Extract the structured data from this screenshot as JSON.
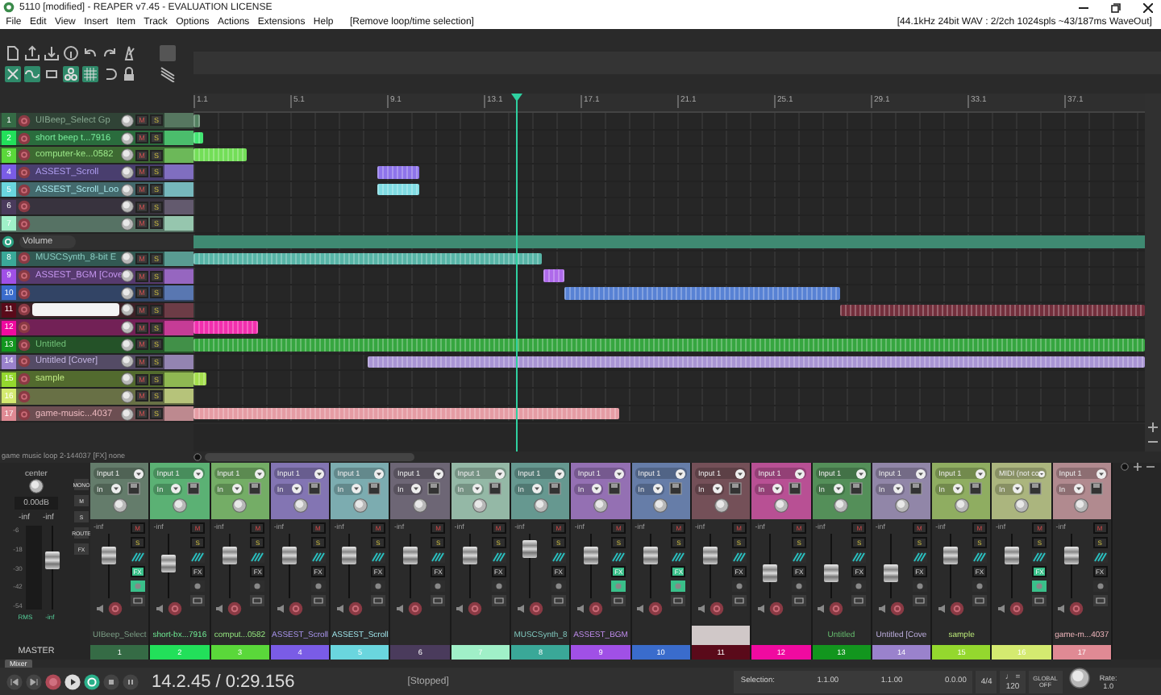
{
  "window": {
    "title": "5110 [modified] - REAPER v7.45 - EVALUATION LICENSE"
  },
  "menu": [
    "File",
    "Edit",
    "View",
    "Insert",
    "Item",
    "Track",
    "Options",
    "Actions",
    "Extensions",
    "Help"
  ],
  "menu_hint": "[Remove loop/time selection]",
  "audio_status": "[44.1kHz 24bit WAV : 2/2ch 1024spls ~43/187ms WaveOut]",
  "toolbar": [
    {
      "on": false
    },
    {
      "on": false
    },
    {
      "on": false
    },
    {
      "on": false
    },
    {
      "on": false
    },
    {
      "on": false
    },
    {
      "on": false
    },
    {
      "on": true
    },
    {
      "on": true
    },
    {
      "on": false
    },
    {
      "on": true
    },
    {
      "on": true
    },
    {
      "on": false
    },
    {
      "on": false
    }
  ],
  "ruler": [
    "1.1",
    "5.1",
    "9.1",
    "13.1",
    "17.1",
    "21.1",
    "25.1",
    "29.1",
    "33.1",
    "37.1"
  ],
  "tracks": [
    {
      "kind": "track",
      "number": "1",
      "name": "UIBeep_Select Gp",
      "color": "#356b45",
      "selected": false,
      "buttons": [
        "M",
        "S"
      ]
    },
    {
      "kind": "track",
      "number": "2",
      "name": "short beep t...7916",
      "color": "#22e05a",
      "selected": false,
      "buttons": [
        "M",
        "S"
      ]
    },
    {
      "kind": "track",
      "number": "3",
      "name": "computer-ke...0582",
      "color": "#5ad83a",
      "selected": false,
      "buttons": [
        "M",
        "S"
      ]
    },
    {
      "kind": "track",
      "number": "4",
      "name": "ASSEST_Scroll",
      "color": "#7a5ce6",
      "selected": false,
      "buttons": [
        "M",
        "S"
      ]
    },
    {
      "kind": "track",
      "number": "5",
      "name": "ASSEST_Scroll_Loo",
      "color": "#6ad6de",
      "selected": false,
      "buttons": [
        "M",
        "S"
      ]
    },
    {
      "kind": "track",
      "number": "6",
      "color": "#4a3b5c",
      "selected": false,
      "buttons": [
        "M",
        "S"
      ]
    },
    {
      "kind": "track",
      "number": "7",
      "color": "#a0f0c8",
      "selected": false,
      "buttons": [
        "M",
        "S"
      ]
    },
    {
      "kind": "envelope",
      "name": "Volume"
    },
    {
      "kind": "track",
      "number": "8",
      "name": "MUSCSynth_8-bit E",
      "color": "#3aa898",
      "selected": false,
      "buttons": [
        "M",
        "S"
      ]
    },
    {
      "kind": "track",
      "number": "9",
      "name": "ASSEST_BGM [Cove",
      "color": "#a050e6",
      "selected": false,
      "buttons": [
        "M",
        "S"
      ]
    },
    {
      "kind": "track",
      "number": "10",
      "color": "#3a6ccc",
      "selected": false,
      "buttons": [
        "M",
        "S"
      ]
    },
    {
      "kind": "track",
      "number": "11",
      "color": "#5a0a1a",
      "selected": true,
      "buttons": [
        "M",
        "S"
      ]
    },
    {
      "kind": "track",
      "number": "12",
      "color": "#f00aa0",
      "selected": false,
      "buttons": [
        "M",
        "S"
      ]
    },
    {
      "kind": "track",
      "number": "13",
      "name": "Untitled",
      "color": "#12961e",
      "selected": false,
      "buttons": [
        "M",
        "S"
      ]
    },
    {
      "kind": "track",
      "number": "14",
      "name": "Untitled [Cover]",
      "color": "#9a82cc",
      "selected": false,
      "buttons": [
        "M",
        "S"
      ]
    },
    {
      "kind": "track",
      "number": "15",
      "name": "sample",
      "color": "#94d82e",
      "selected": false,
      "buttons": [
        "M",
        "S"
      ]
    },
    {
      "kind": "track",
      "number": "16",
      "color": "#d4ea70",
      "selected": false,
      "buttons": [
        "M",
        "S"
      ]
    },
    {
      "kind": "track",
      "number": "17",
      "name": "game-music...4037",
      "color": "#e08a94",
      "selected": false,
      "buttons": [
        "M",
        "S"
      ]
    }
  ],
  "status_line": "game music loop 2-144037 [FX] none",
  "master": {
    "pan_label": "center",
    "volume": "0.00dB",
    "peaks": [
      "-inf",
      "-inf"
    ],
    "meter_ticks": [
      "-6",
      "-18",
      "-30",
      "-42",
      "-54"
    ],
    "rms": "RMS",
    "rms_value": "-inf",
    "label": "MASTER",
    "level": 0.6,
    "side_buttons": [
      "MONO",
      "M",
      "S",
      "ROUTE",
      "FX"
    ]
  },
  "mixer": [
    {
      "number": "1",
      "name": "UIBeep_Select",
      "input": "Input 1",
      "monitor": "In",
      "peak": "-inf",
      "level": 0.72,
      "fx_active": true,
      "selected": false,
      "color": "#356b45",
      "buttons": [
        "M",
        "S",
        "FX"
      ]
    },
    {
      "number": "2",
      "name": "short-bx...7916",
      "input": "Input 1",
      "monitor": "In",
      "peak": "-inf",
      "level": 0.55,
      "fx_active": false,
      "selected": false,
      "color": "#22e05a",
      "buttons": [
        "M",
        "S",
        "FX"
      ]
    },
    {
      "number": "3",
      "name": "comput...0582",
      "input": "Input 1",
      "monitor": "In",
      "peak": "-inf",
      "level": 0.72,
      "fx_active": false,
      "selected": false,
      "color": "#5ad83a",
      "buttons": [
        "M",
        "S",
        "FX"
      ]
    },
    {
      "number": "4",
      "name": "ASSEST_Scroll",
      "input": "Input 1",
      "monitor": "In",
      "peak": "-inf",
      "level": 0.72,
      "fx_active": false,
      "selected": false,
      "color": "#7a5ce6",
      "buttons": [
        "M",
        "S",
        "FX"
      ]
    },
    {
      "number": "5",
      "name": "ASSEST_Scroll",
      "input": "Input 1",
      "monitor": "In",
      "peak": "-inf",
      "level": 0.72,
      "fx_active": false,
      "selected": false,
      "color": "#6ad6de",
      "buttons": [
        "M",
        "S",
        "FX"
      ]
    },
    {
      "number": "6",
      "input": "Input 1",
      "monitor": "In",
      "peak": "-inf",
      "level": 0.72,
      "fx_active": false,
      "selected": false,
      "color": "#4a3b5c",
      "buttons": [
        "M",
        "S",
        "FX"
      ]
    },
    {
      "number": "7",
      "input": "Input 1",
      "monitor": "In",
      "peak": "-inf",
      "level": 0.72,
      "fx_active": false,
      "selected": false,
      "color": "#a0f0c8",
      "buttons": [
        "M",
        "S",
        "FX"
      ]
    },
    {
      "number": "8",
      "name": "MUSCSynth_8",
      "input": "Input 1",
      "monitor": "In",
      "peak": "-inf",
      "level": 0.85,
      "fx_active": false,
      "selected": false,
      "color": "#3aa898",
      "buttons": [
        "M",
        "S",
        "FX"
      ]
    },
    {
      "number": "9",
      "name": "ASSEST_BGM",
      "input": "Input 1",
      "monitor": "In",
      "peak": "-inf",
      "level": 0.72,
      "fx_active": true,
      "selected": false,
      "color": "#a050e6",
      "buttons": [
        "M",
        "S",
        "FX"
      ]
    },
    {
      "number": "10",
      "input": "Input 1",
      "monitor": "In",
      "peak": "-inf",
      "level": 0.72,
      "fx_active": true,
      "selected": false,
      "color": "#3a6ccc",
      "buttons": [
        "M",
        "S",
        "FX"
      ]
    },
    {
      "number": "11",
      "input": "Input 1",
      "monitor": "In",
      "peak": "-inf",
      "level": 0.72,
      "fx_active": false,
      "selected": true,
      "color": "#5a0a1a",
      "buttons": [
        "M",
        "S",
        "FX"
      ]
    },
    {
      "number": "12",
      "input": "Input 1",
      "monitor": "In",
      "peak": "-inf",
      "level": 0.35,
      "fx_active": false,
      "selected": false,
      "color": "#f00aa0",
      "buttons": [
        "M",
        "S",
        "FX"
      ]
    },
    {
      "number": "13",
      "name": "Untitled",
      "input": "Input 1",
      "monitor": "In",
      "peak": "-inf",
      "level": 0.35,
      "fx_active": false,
      "selected": false,
      "color": "#12961e",
      "buttons": [
        "M",
        "S",
        "FX"
      ]
    },
    {
      "number": "14",
      "name": "Untitled [Cove",
      "input": "Input 1",
      "monitor": "In",
      "peak": "-inf",
      "level": 0.35,
      "fx_active": false,
      "selected": false,
      "color": "#9a82cc",
      "buttons": [
        "M",
        "S",
        "FX"
      ]
    },
    {
      "number": "15",
      "name": "sample",
      "input": "Input 1",
      "monitor": "In",
      "peak": "-inf",
      "level": 0.72,
      "fx_active": false,
      "selected": false,
      "color": "#94d82e",
      "buttons": [
        "M",
        "S",
        "FX"
      ]
    },
    {
      "number": "16",
      "input": "MIDI (not co",
      "monitor": "In",
      "peak": "-inf",
      "level": 0.72,
      "fx_active": true,
      "selected": false,
      "color": "#d4ea70",
      "buttons": [
        "M",
        "S",
        "FX"
      ]
    },
    {
      "number": "17",
      "name": "game-m...4037",
      "input": "Input 1",
      "monitor": "In",
      "peak": "-inf",
      "level": 0.72,
      "fx_active": false,
      "selected": false,
      "color": "#e08a94",
      "buttons": [
        "M",
        "S",
        "FX"
      ]
    }
  ],
  "mixer_tab": "Mixer",
  "transport": {
    "position": "14.2.45 / 0:29.156",
    "state": "[Stopped]",
    "selection_label": "Selection:",
    "selection": [
      "1.1.00",
      "1.1.00",
      "0.0.00"
    ],
    "time_signature": "4/4",
    "tempo_symbol": "♩ =",
    "tempo": "120",
    "global": "GLOBAL",
    "global_state": "OFF",
    "rate_label": "Rate:",
    "rate": "1.0"
  }
}
